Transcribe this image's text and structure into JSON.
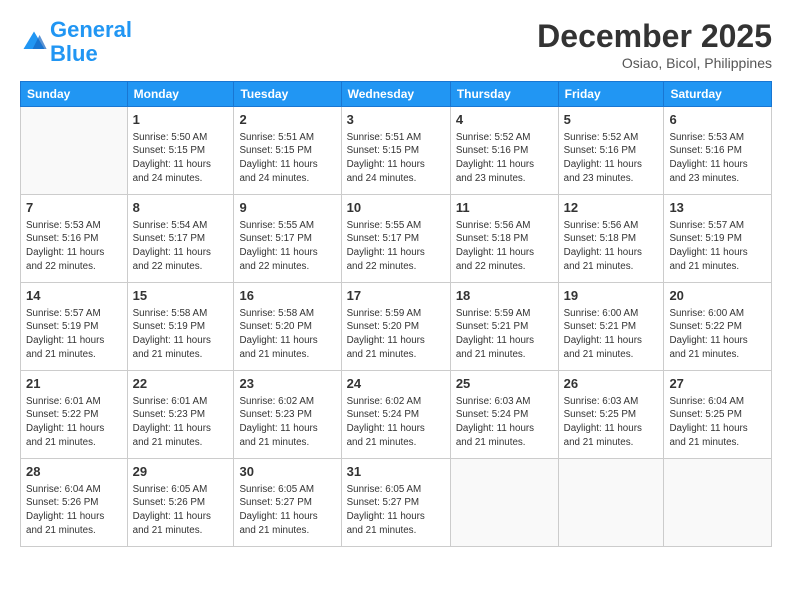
{
  "header": {
    "logo_line1": "General",
    "logo_line2": "Blue",
    "month": "December 2025",
    "location": "Osiao, Bicol, Philippines"
  },
  "weekdays": [
    "Sunday",
    "Monday",
    "Tuesday",
    "Wednesday",
    "Thursday",
    "Friday",
    "Saturday"
  ],
  "weeks": [
    [
      {
        "num": "",
        "info": ""
      },
      {
        "num": "1",
        "info": "Sunrise: 5:50 AM\nSunset: 5:15 PM\nDaylight: 11 hours\nand 24 minutes."
      },
      {
        "num": "2",
        "info": "Sunrise: 5:51 AM\nSunset: 5:15 PM\nDaylight: 11 hours\nand 24 minutes."
      },
      {
        "num": "3",
        "info": "Sunrise: 5:51 AM\nSunset: 5:15 PM\nDaylight: 11 hours\nand 24 minutes."
      },
      {
        "num": "4",
        "info": "Sunrise: 5:52 AM\nSunset: 5:16 PM\nDaylight: 11 hours\nand 23 minutes."
      },
      {
        "num": "5",
        "info": "Sunrise: 5:52 AM\nSunset: 5:16 PM\nDaylight: 11 hours\nand 23 minutes."
      },
      {
        "num": "6",
        "info": "Sunrise: 5:53 AM\nSunset: 5:16 PM\nDaylight: 11 hours\nand 23 minutes."
      }
    ],
    [
      {
        "num": "7",
        "info": "Sunrise: 5:53 AM\nSunset: 5:16 PM\nDaylight: 11 hours\nand 22 minutes."
      },
      {
        "num": "8",
        "info": "Sunrise: 5:54 AM\nSunset: 5:17 PM\nDaylight: 11 hours\nand 22 minutes."
      },
      {
        "num": "9",
        "info": "Sunrise: 5:55 AM\nSunset: 5:17 PM\nDaylight: 11 hours\nand 22 minutes."
      },
      {
        "num": "10",
        "info": "Sunrise: 5:55 AM\nSunset: 5:17 PM\nDaylight: 11 hours\nand 22 minutes."
      },
      {
        "num": "11",
        "info": "Sunrise: 5:56 AM\nSunset: 5:18 PM\nDaylight: 11 hours\nand 22 minutes."
      },
      {
        "num": "12",
        "info": "Sunrise: 5:56 AM\nSunset: 5:18 PM\nDaylight: 11 hours\nand 21 minutes."
      },
      {
        "num": "13",
        "info": "Sunrise: 5:57 AM\nSunset: 5:19 PM\nDaylight: 11 hours\nand 21 minutes."
      }
    ],
    [
      {
        "num": "14",
        "info": "Sunrise: 5:57 AM\nSunset: 5:19 PM\nDaylight: 11 hours\nand 21 minutes."
      },
      {
        "num": "15",
        "info": "Sunrise: 5:58 AM\nSunset: 5:19 PM\nDaylight: 11 hours\nand 21 minutes."
      },
      {
        "num": "16",
        "info": "Sunrise: 5:58 AM\nSunset: 5:20 PM\nDaylight: 11 hours\nand 21 minutes."
      },
      {
        "num": "17",
        "info": "Sunrise: 5:59 AM\nSunset: 5:20 PM\nDaylight: 11 hours\nand 21 minutes."
      },
      {
        "num": "18",
        "info": "Sunrise: 5:59 AM\nSunset: 5:21 PM\nDaylight: 11 hours\nand 21 minutes."
      },
      {
        "num": "19",
        "info": "Sunrise: 6:00 AM\nSunset: 5:21 PM\nDaylight: 11 hours\nand 21 minutes."
      },
      {
        "num": "20",
        "info": "Sunrise: 6:00 AM\nSunset: 5:22 PM\nDaylight: 11 hours\nand 21 minutes."
      }
    ],
    [
      {
        "num": "21",
        "info": "Sunrise: 6:01 AM\nSunset: 5:22 PM\nDaylight: 11 hours\nand 21 minutes."
      },
      {
        "num": "22",
        "info": "Sunrise: 6:01 AM\nSunset: 5:23 PM\nDaylight: 11 hours\nand 21 minutes."
      },
      {
        "num": "23",
        "info": "Sunrise: 6:02 AM\nSunset: 5:23 PM\nDaylight: 11 hours\nand 21 minutes."
      },
      {
        "num": "24",
        "info": "Sunrise: 6:02 AM\nSunset: 5:24 PM\nDaylight: 11 hours\nand 21 minutes."
      },
      {
        "num": "25",
        "info": "Sunrise: 6:03 AM\nSunset: 5:24 PM\nDaylight: 11 hours\nand 21 minutes."
      },
      {
        "num": "26",
        "info": "Sunrise: 6:03 AM\nSunset: 5:25 PM\nDaylight: 11 hours\nand 21 minutes."
      },
      {
        "num": "27",
        "info": "Sunrise: 6:04 AM\nSunset: 5:25 PM\nDaylight: 11 hours\nand 21 minutes."
      }
    ],
    [
      {
        "num": "28",
        "info": "Sunrise: 6:04 AM\nSunset: 5:26 PM\nDaylight: 11 hours\nand 21 minutes."
      },
      {
        "num": "29",
        "info": "Sunrise: 6:05 AM\nSunset: 5:26 PM\nDaylight: 11 hours\nand 21 minutes."
      },
      {
        "num": "30",
        "info": "Sunrise: 6:05 AM\nSunset: 5:27 PM\nDaylight: 11 hours\nand 21 minutes."
      },
      {
        "num": "31",
        "info": "Sunrise: 6:05 AM\nSunset: 5:27 PM\nDaylight: 11 hours\nand 21 minutes."
      },
      {
        "num": "",
        "info": ""
      },
      {
        "num": "",
        "info": ""
      },
      {
        "num": "",
        "info": ""
      }
    ]
  ]
}
